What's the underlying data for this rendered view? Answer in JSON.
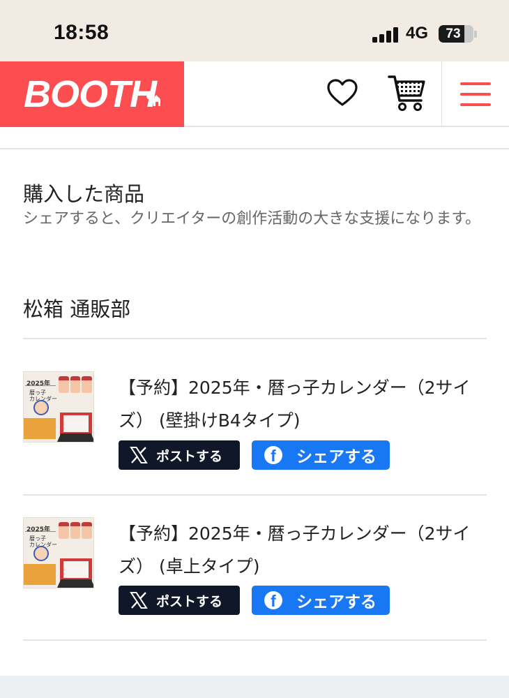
{
  "status_bar": {
    "time": "18:58",
    "network": "4G",
    "battery": "73",
    "battery_level": 0.73
  },
  "header": {
    "logo_text": "BOOTH",
    "icons": [
      "heart-icon",
      "cart-icon",
      "menu-icon"
    ],
    "brand_color": "#fc4d50"
  },
  "purchase": {
    "title": "購入した商品",
    "description": "シェアすると、クリエイターの創作活動の大きな支援になります。"
  },
  "shop": {
    "name": "松箱 通販部"
  },
  "items": [
    {
      "title": "【予約】2025年・暦っ子カレンダー（2サイズ） (壁掛けB4タイプ)",
      "thumb_year": "2025年",
      "thumb_sub": "暦っ子\nカレンダー",
      "post_label": "ポストする",
      "share_label": "シェアする"
    },
    {
      "title": "【予約】2025年・暦っ子カレンダー（2サイズ） (卓上タイプ)",
      "thumb_year": "2025年",
      "thumb_sub": "暦っ子\nカレンダー",
      "post_label": "ポストする",
      "share_label": "シェアする"
    }
  ],
  "colors": {
    "x_button": "#0f1729",
    "facebook_button": "#1877f2"
  }
}
